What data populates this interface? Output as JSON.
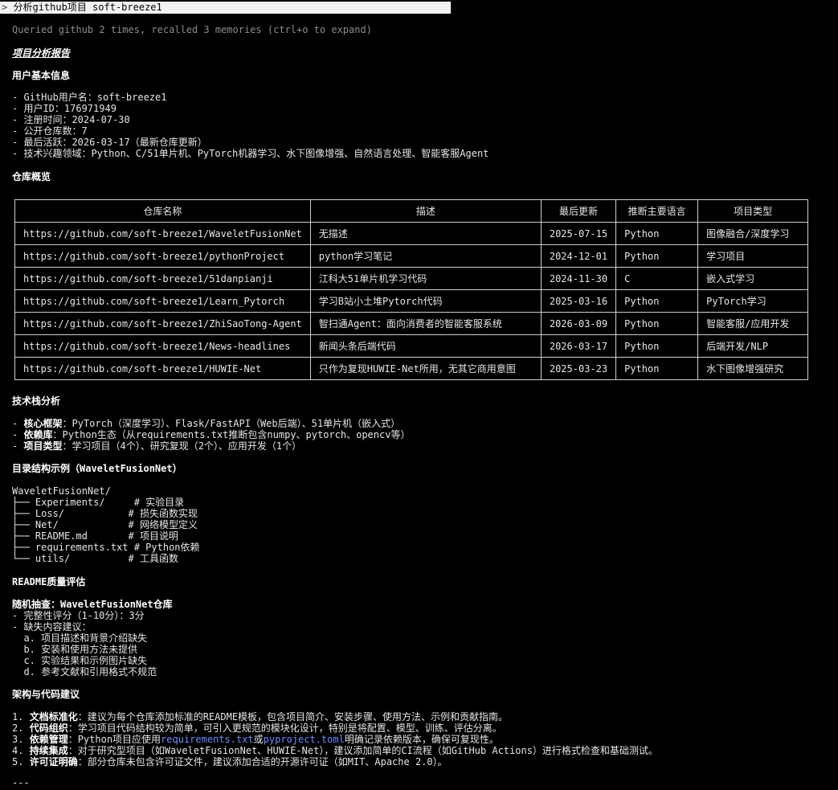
{
  "prompt": {
    "caret": ">",
    "text": "分析github项目 soft-breeze1"
  },
  "status": "Queried github 2 times, recalled 3 memories (ctrl+o to expand)",
  "report_title": "项目分析报告",
  "user": {
    "heading": "用户基本信息",
    "items": [
      "- GitHub用户名：soft-breeze1",
      "- 用户ID：176971949",
      "- 注册时间：2024-07-30",
      "- 公开仓库数：7",
      "- 最后活跃：2026-03-17（最新仓库更新）",
      "- 技术兴趣领域：Python、C/51单片机、PyTorch机器学习、水下图像增强、自然语言处理、智能客服Agent"
    ]
  },
  "repos": {
    "heading": "仓库概览",
    "columns": [
      "仓库名称",
      "描述",
      "最后更新",
      "推断主要语言",
      "项目类型"
    ],
    "rows": [
      [
        "https://github.com/soft-breeze1/WaveletFusionNet",
        "无描述",
        "2025-07-15",
        "Python",
        "图像融合/深度学习"
      ],
      [
        "https://github.com/soft-breeze1/pythonProject",
        "python学习笔记",
        "2024-12-01",
        "Python",
        "学习项目"
      ],
      [
        "https://github.com/soft-breeze1/51danpianji",
        "江科大51单片机学习代码",
        "2024-11-30",
        "C",
        "嵌入式学习"
      ],
      [
        "https://github.com/soft-breeze1/Learn_Pytorch",
        "学习B站小土堆Pytorch代码",
        "2025-03-16",
        "Python",
        "PyTorch学习"
      ],
      [
        "https://github.com/soft-breeze1/ZhiSaoTong-Agent",
        "智扫通Agent：面向消费者的智能客服系统",
        "2026-03-09",
        "Python",
        "智能客服/应用开发"
      ],
      [
        "https://github.com/soft-breeze1/News-headlines",
        "新闻头条后端代码",
        "2026-03-17",
        "Python",
        "后端开发/NLP"
      ],
      [
        "https://github.com/soft-breeze1/HUWIE-Net",
        "只作为复现HUWIE-Net所用，无其它商用意图",
        "2025-03-23",
        "Python",
        "水下图像增强研究"
      ]
    ]
  },
  "tech": {
    "heading": "技术栈分析",
    "items": [
      {
        "prefix": "- ",
        "label": "核心框架",
        "text": "：PyTorch（深度学习）、Flask/FastAPI（Web后端）、51单片机（嵌入式）"
      },
      {
        "prefix": "- ",
        "label": "依赖库",
        "text": "：Python生态（从requirements.txt推断包含numpy、pytorch、opencv等）"
      },
      {
        "prefix": "- ",
        "label": "项目类型",
        "text": "：学习项目（4个）、研究复现（2个）、应用开发（1个）"
      }
    ]
  },
  "tree": {
    "heading": "目录结构示例（WaveletFusionNet）",
    "lines": [
      "WaveletFusionNet/",
      "├── Experiments/     # 实验目录",
      "├── Loss/           # 损失函数实现",
      "├── Net/            # 网络模型定义",
      "├── README.md       # 项目说明",
      "├── requirements.txt # Python依赖",
      "└── utils/          # 工具函数"
    ]
  },
  "readme": {
    "heading": "README质量评估",
    "subheading": "随机抽查：WaveletFusionNet仓库",
    "items": [
      "- 完整性评分（1-10分）：3分",
      "- 缺失内容建议：",
      "  a. 项目描述和背景介绍缺失",
      "  b. 安装和使用方法未提供",
      "  c. 实验结果和示例图片缺失",
      "  d. 参考文献和引用格式不规范"
    ]
  },
  "arch": {
    "heading": "架构与代码建议",
    "items": [
      {
        "num": "1. ",
        "label": "文档标准化",
        "text": "：建议为每个仓库添加标准的README模板，包含项目简介、安装步骤、使用方法、示例和贡献指南。"
      },
      {
        "num": "2. ",
        "label": "代码组织",
        "text": "：学习项目代码结构较为简单，可引入更规范的模块化设计，特别是将配置、模型、训练、评估分离。"
      },
      {
        "num": "3. ",
        "label": "依赖管理",
        "pre": "：Python项目应使用",
        "link1": "requirements.txt",
        "mid": "或",
        "link2": "pyproject.toml",
        "post": "明确记录依赖版本，确保可复现性。"
      },
      {
        "num": "4. ",
        "label": "持续集成",
        "text": "：对于研究型项目（如WaveletFusionNet、HUWIE-Net），建议添加简单的CI流程（如GitHub Actions）进行格式检查和基础测试。"
      },
      {
        "num": "5. ",
        "label": "许可证明确",
        "text": "：部分仓库未包含许可证文件，建议添加合适的开源许可证（如MIT、Apache 2.0）。"
      }
    ]
  },
  "footer_rule": "---"
}
